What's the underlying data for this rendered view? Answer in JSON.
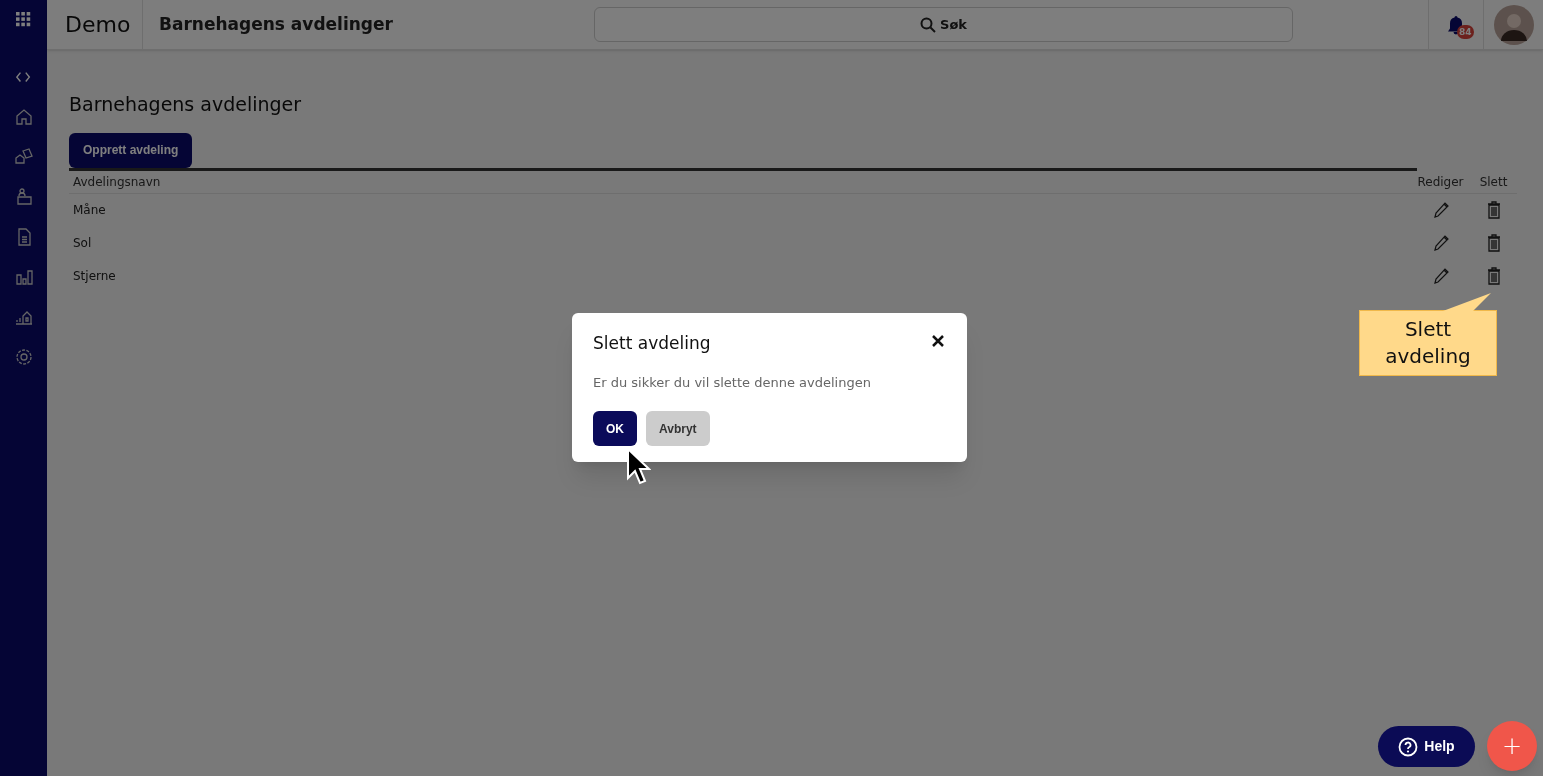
{
  "header": {
    "app_name": "Demo",
    "page_title": "Barnehagens avdelinger",
    "search": {
      "placeholder": "Søk"
    },
    "notification_count": "84"
  },
  "page": {
    "title": "Barnehagens avdelinger",
    "create_button": "Opprett avdeling",
    "table": {
      "columns": [
        "Avdelingsnavn",
        "Rediger",
        "Slett"
      ],
      "rows": [
        {
          "name": "Måne"
        },
        {
          "name": "Sol"
        },
        {
          "name": "Stjerne"
        }
      ]
    }
  },
  "dialog": {
    "title": "Slett avdeling",
    "message": "Er du sikker du vil slette denne avdelingen",
    "buttons": [
      {
        "label": "OK",
        "kind": "primary"
      },
      {
        "label": "Avbryt",
        "kind": "secondary"
      }
    ]
  },
  "tooltip": {
    "text": "Slett avdeling"
  },
  "help_button": "Help",
  "add_button": "+"
}
